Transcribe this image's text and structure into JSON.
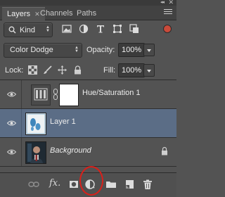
{
  "window": {
    "collapse_glyph": "◂◂",
    "close_glyph": "✕"
  },
  "tabs": [
    {
      "label": "Layers",
      "close": "✕"
    },
    {
      "label": "Channels"
    },
    {
      "label": "Paths"
    }
  ],
  "filter": {
    "kind_label": "Kind",
    "search_icon": "search-icon",
    "icons": [
      "pixel-layer-filter-icon",
      "adjustment-layer-filter-icon",
      "type-layer-filter-icon",
      "shape-layer-filter-icon",
      "smart-object-filter-icon"
    ]
  },
  "blend": {
    "mode": "Color Dodge",
    "opacity_label": "Opacity:",
    "opacity_value": "100%"
  },
  "lock": {
    "label": "Lock:",
    "fill_label": "Fill:",
    "fill_value": "100%",
    "icons": [
      "lock-transparent-pixels-icon",
      "lock-image-pixels-icon",
      "lock-position-icon",
      "lock-all-icon"
    ]
  },
  "layers": [
    {
      "name": "Hue/Saturation 1",
      "italic": false,
      "selected": false,
      "type": "adjustment"
    },
    {
      "name": "Layer 1",
      "italic": false,
      "selected": true,
      "type": "pixel"
    },
    {
      "name": "Background",
      "italic": true,
      "selected": false,
      "type": "background",
      "locked": true
    }
  ],
  "footer": {
    "fx_label": "fx.",
    "icons": [
      "link-layers-icon",
      "layer-style-icon",
      "layer-mask-icon",
      "new-adjustment-layer-icon",
      "new-group-icon",
      "new-layer-icon",
      "trash-icon"
    ],
    "highlight_color": "#d9201a"
  },
  "colors": {
    "panel": "#535353",
    "selected_row": "#5b6d86",
    "highlight": "#d9201a"
  }
}
